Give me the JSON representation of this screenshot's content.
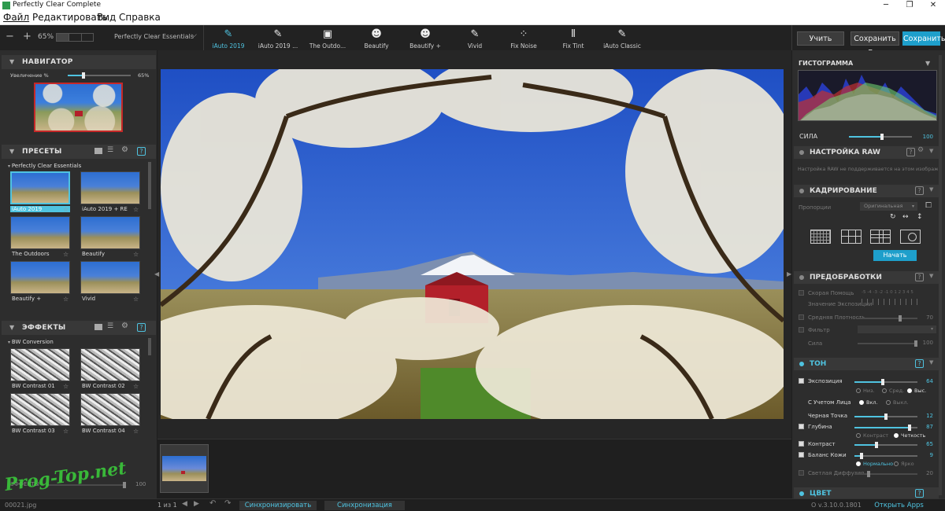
{
  "app": {
    "title": "Perfectly Clear Complete"
  },
  "menu": [
    "Файл",
    "Редактировать",
    "Вид",
    "Справка"
  ],
  "toolbar": {
    "zoom_minus": "−",
    "zoom_plus": "+",
    "zoom": "65%",
    "preset_select": "Perfectly Clear Essentials",
    "presets": [
      {
        "label": "iAuto 2019",
        "icon": "brush-2019-icon",
        "active": true
      },
      {
        "label": "iAuto 2019 ...",
        "icon": "brush-2019-icon"
      },
      {
        "label": "The Outdo...",
        "icon": "landscape-icon"
      },
      {
        "label": "Beautify",
        "icon": "face-icon"
      },
      {
        "label": "Beautify +",
        "icon": "face-plus-icon"
      },
      {
        "label": "Vivid",
        "icon": "brush-icon"
      },
      {
        "label": "Fix Noise",
        "icon": "noise-icon"
      },
      {
        "label": "Fix Tint",
        "icon": "thermometer-icon"
      },
      {
        "label": "iAuto Classic",
        "icon": "brush-hd-icon"
      }
    ],
    "learn": "Учить",
    "save_all": "Сохранить Все",
    "save": "Сохранить"
  },
  "navigator": {
    "title": "НАВИГАТОР",
    "zoom_label": "Увеличение %",
    "zoom_value": "65%"
  },
  "presets_panel": {
    "title": "ПРЕСЕТЫ",
    "group": "Perfectly Clear Essentials",
    "items": [
      {
        "label": "iAuto 2019",
        "selected": true
      },
      {
        "label": "iAuto 2019 + RE"
      },
      {
        "label": "The Outdoors"
      },
      {
        "label": "Beautify"
      },
      {
        "label": "Beautify +"
      },
      {
        "label": "Vivid"
      }
    ]
  },
  "effects_panel": {
    "title": "ЭФФЕКТЫ",
    "group": "BW Conversion",
    "items": [
      {
        "label": "BW Contrast 01"
      },
      {
        "label": "BW Contrast 02"
      },
      {
        "label": "BW Contrast 03"
      },
      {
        "label": "BW Contrast 04"
      }
    ],
    "footer_label": "ЭФФЕКТЫ",
    "footer_value": "100"
  },
  "status": {
    "filename": "00021.jpg",
    "pages": "1 из 1",
    "sync_all": "Синхронизировать все",
    "sync_forward": "Синхронизация Вперёд",
    "version": "О v.3.10.0.1801",
    "open_apps": "Открыть Apps Manager"
  },
  "watermark": "Prog-Top.net",
  "right": {
    "histogram": {
      "title": "ГИСТОГРАММА"
    },
    "strength": {
      "label": "СИЛА",
      "value": "100",
      "level": 1.0
    },
    "raw": {
      "title": "НАСТРОЙКА RAW",
      "message": "Настройка RAW не поддерживается на этом изображении"
    },
    "crop": {
      "title": "КАДРИРОВАНИЕ",
      "proportions_label": "Пропорции",
      "proportions_value": "Оригинальная",
      "start_button": "Начать"
    },
    "preprocess": {
      "title": "ПРЕДОБРАБОТКИ",
      "quick_help": "Скорая Помощь",
      "exposure_value_label": "Значение Экспозиции",
      "scale": "-5 -4 -3 -2 -1 0 1 2 3 4 5",
      "mid_density": "Средняя Плотность",
      "mid_density_value": "70",
      "filter": "Фильтр",
      "strength": "Сила",
      "strength_value": "100"
    },
    "tone": {
      "title": "ТОН",
      "exposure": "Экспозиция",
      "exposure_value": "64",
      "low": "Низ.",
      "mid": "Сред.",
      "high": "Выс.",
      "face_aware": "С Учетом Лица",
      "on": "Вкл.",
      "off": "Выкл.",
      "black_point": "Черная Точка",
      "black_point_value": "12",
      "depth": "Глубина",
      "depth_value": "87",
      "contrast_opt": "Контраст",
      "clarity_opt": "Четкость",
      "contrast": "Контраст",
      "contrast_value": "65",
      "skin_balance": "Баланс Кожи",
      "skin_balance_value": "9",
      "normal": "Нормально",
      "bright": "Ярко",
      "light_diffusion": "Светлая Диффузия",
      "light_diffusion_value": "20"
    },
    "color": {
      "title": "ЦВЕТ"
    }
  },
  "colors": {
    "accent": "#4fc3e0",
    "save_button": "#1e9fcb",
    "sky": "#2a5bd0",
    "barn": "#b3202a"
  }
}
